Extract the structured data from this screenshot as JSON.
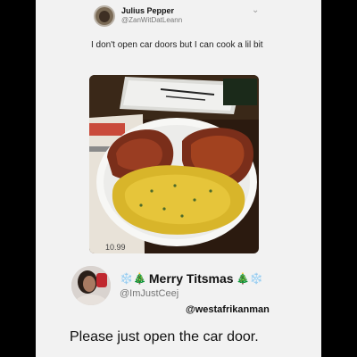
{
  "tweet": {
    "name": "Julius Pepper",
    "handle": "@ZanWitDatLeann",
    "text": "I don't open car doors but I can cook a lil bit"
  },
  "photo": {
    "price_tag": "10.99"
  },
  "reply": {
    "name": "Merry Titsmas",
    "name_prefix_emoji": "❄️🎄",
    "name_suffix_emoji": "🎄❄️",
    "handle": "@ImJustCeej",
    "mention": "@westafrikanman",
    "text": "Please just open the car door."
  }
}
